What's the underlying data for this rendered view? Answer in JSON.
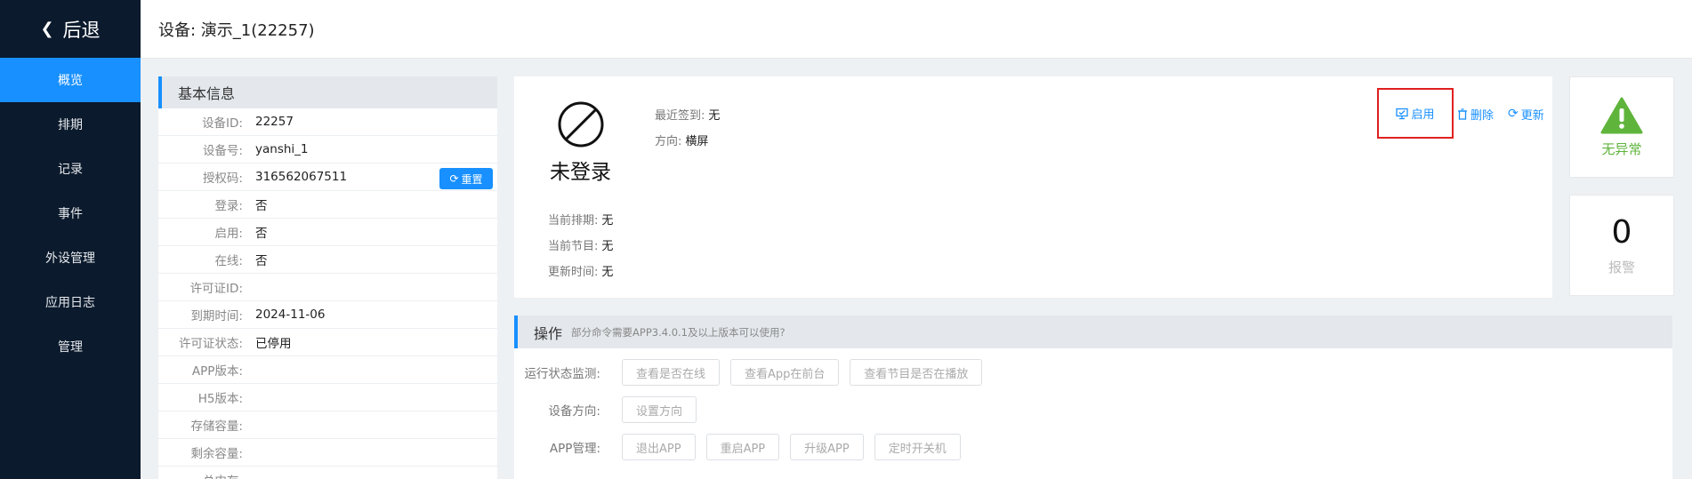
{
  "sidebar": {
    "back_label": "后退",
    "items": [
      "概览",
      "排期",
      "记录",
      "事件",
      "外设管理",
      "应用日志",
      "管理"
    ]
  },
  "header": {
    "title": "设备: 演示_1(22257)"
  },
  "info": {
    "title": "基本信息",
    "rows": [
      {
        "label": "设备ID:",
        "value": "22257"
      },
      {
        "label": "设备号:",
        "value": "yanshi_1"
      },
      {
        "label": "授权码:",
        "value": "316562067511"
      },
      {
        "label": "登录:",
        "value": "否"
      },
      {
        "label": "启用:",
        "value": "否"
      },
      {
        "label": "在线:",
        "value": "否"
      },
      {
        "label": "许可证ID:",
        "value": ""
      },
      {
        "label": "到期时间:",
        "value": "2024-11-06"
      },
      {
        "label": "许可证状态:",
        "value": "已停用"
      },
      {
        "label": "APP版本:",
        "value": ""
      },
      {
        "label": "H5版本:",
        "value": ""
      },
      {
        "label": "存储容量:",
        "value": ""
      },
      {
        "label": "剩余容量:",
        "value": ""
      },
      {
        "label": "总内存:",
        "value": ""
      }
    ],
    "reset_label": "重置"
  },
  "status": {
    "state": "未登录",
    "last_checkin_label": "最近签到:",
    "last_checkin_value": "无",
    "orientation_label": "方向:",
    "orientation_value": "横屏",
    "schedule_label": "当前排期:",
    "schedule_value": "无",
    "program_label": "当前节目:",
    "program_value": "无",
    "update_label": "更新时间:",
    "update_value": "无",
    "actions": {
      "enable": "启用",
      "delete": "删除",
      "update": "更新"
    }
  },
  "cards": {
    "warn_label": "无异常",
    "alarm_count": "0",
    "alarm_label": "报警"
  },
  "ops": {
    "title": "操作",
    "subtitle": "部分命令需要APP3.4.0.1及以上版本可以使用?",
    "rows": [
      {
        "label": "运行状态监测:",
        "buttons": [
          "查看是否在线",
          "查看App在前台",
          "查看节目是否在播放"
        ]
      },
      {
        "label": "设备方向:",
        "buttons": [
          "设置方向"
        ]
      },
      {
        "label": "APP管理:",
        "buttons": [
          "退出APP",
          "重启APP",
          "升级APP",
          "定时开关机"
        ]
      }
    ]
  }
}
